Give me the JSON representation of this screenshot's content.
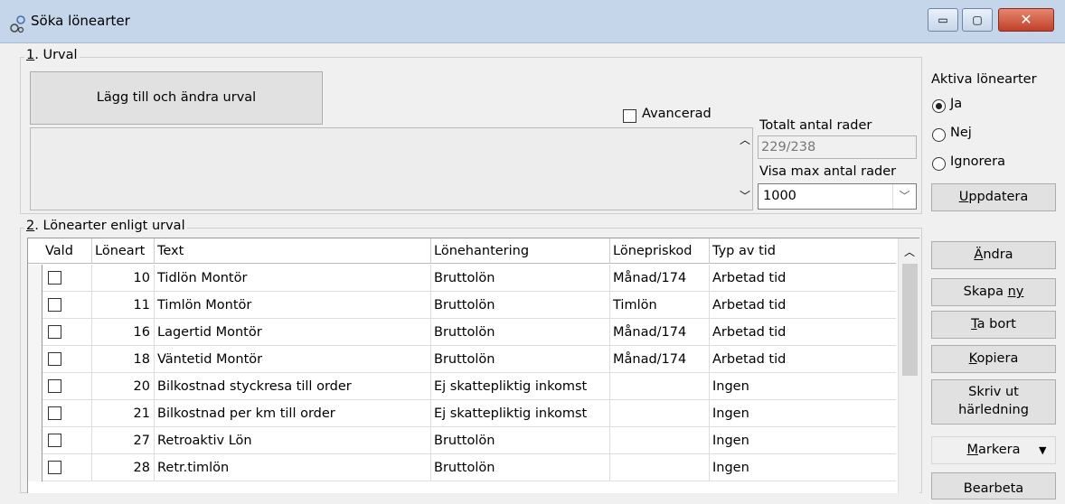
{
  "window": {
    "title": "Söka lönearter",
    "min_glyph": "▭",
    "max_glyph": "▢",
    "close_glyph": "✕"
  },
  "urval": {
    "legend_num": "1",
    "legend_rest": ". Urval",
    "add_button": "Lägg till och ändra urval",
    "advanced_label": "Avancerad",
    "total_label": "Totalt antal rader",
    "total_value": "229/238",
    "max_label": "Visa max antal rader",
    "max_value": "1000",
    "active_title": "Aktiva lönearter",
    "radio_ja": "Ja",
    "radio_nej": "Nej",
    "radio_ignorera": "Ignorera",
    "update_u": "U",
    "update_rest": "ppdatera"
  },
  "lonearter": {
    "legend_num": "2",
    "legend_rest": ". Lönearter enligt urval",
    "columns": [
      "Vald",
      "Löneart",
      "Text",
      "Lönehantering",
      "Lönepriskod",
      "Typ av tid"
    ],
    "rows": [
      {
        "loneart": "10",
        "text": "Tidlön  Montör",
        "hantering": "Bruttolön",
        "priskod": "Månad/174",
        "typ": "Arbetad tid"
      },
      {
        "loneart": "11",
        "text": "Timlön  Montör",
        "hantering": "Bruttolön",
        "priskod": "Timlön",
        "typ": "Arbetad tid"
      },
      {
        "loneart": "16",
        "text": "Lagertid   Montör",
        "hantering": "Bruttolön",
        "priskod": "Månad/174",
        "typ": "Arbetad tid"
      },
      {
        "loneart": "18",
        "text": "Väntetid  Montör",
        "hantering": "Bruttolön",
        "priskod": "Månad/174",
        "typ": "Arbetad tid"
      },
      {
        "loneart": "20",
        "text": "Bilkostnad styckresa till order",
        "hantering": "Ej skattepliktig inkomst",
        "priskod": "",
        "typ": "Ingen"
      },
      {
        "loneart": "21",
        "text": "Bilkostnad per km till order",
        "hantering": "Ej skattepliktig inkomst",
        "priskod": "",
        "typ": "Ingen"
      },
      {
        "loneart": "27",
        "text": "Retroaktiv Lön",
        "hantering": "Bruttolön",
        "priskod": "",
        "typ": "Ingen"
      },
      {
        "loneart": "28",
        "text": "Retr.timlön",
        "hantering": "Bruttolön",
        "priskod": "",
        "typ": "Ingen"
      }
    ]
  },
  "actions": {
    "andra_u": "Ä",
    "andra_rest": "ndra",
    "skapa_pre": "Skapa ",
    "skapa_u": "ny",
    "tabort_u": "T",
    "tabort_rest": "a bort",
    "kopiera_u": "K",
    "kopiera_rest": "opiera",
    "skriv_line1": "Skriv ut",
    "skriv_line2": "härledning",
    "markera_u": "M",
    "markera_rest": "arkera",
    "bearbeta": "Bearbeta"
  }
}
